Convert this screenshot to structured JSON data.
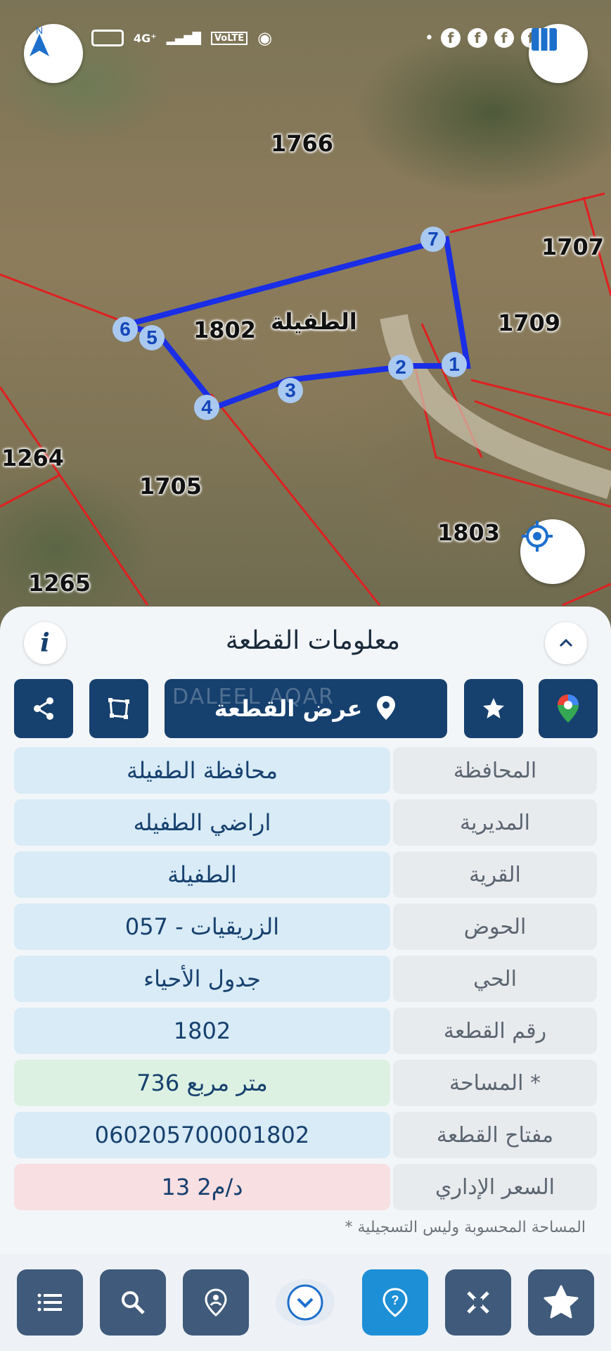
{
  "status_bar": {
    "network": "4G⁺",
    "volte": "VoLTE"
  },
  "map": {
    "parcels": [
      "1766",
      "1707",
      "1709",
      "1802",
      "1264",
      "1705",
      "1803",
      "1265"
    ],
    "area_label": "الطفيلة",
    "vertices": [
      "1",
      "2",
      "3",
      "4",
      "5",
      "6",
      "7"
    ],
    "colors": {
      "selected_outline": "#1a2ee6",
      "parcel_lines": "#e02020"
    }
  },
  "panel": {
    "title": "معلومات القطعة",
    "show_parcel_label": "عرض القطعة",
    "watermark": "DALEEL AQAR",
    "rows": [
      {
        "label": "المحافظة",
        "value": "محافظة الطفيلة",
        "bg": "#d8ebf6"
      },
      {
        "label": "المديرية",
        "value": "اراضي الطفيله",
        "bg": "#d8ebf6"
      },
      {
        "label": "القرية",
        "value": "الطفيلة",
        "bg": "#d8ebf6"
      },
      {
        "label": "الحوض",
        "value": "الزريقيات - 057",
        "bg": "#d8ebf6"
      },
      {
        "label": "الحي",
        "value": "جدول الأحياء",
        "bg": "#d8ebf6"
      },
      {
        "label": "رقم القطعة",
        "value": "1802",
        "bg": "#d8ebf6"
      },
      {
        "label": "المساحة *",
        "value": "736  متر مربع",
        "bg": "#dcf1e2"
      },
      {
        "label": "مفتاح القطعة",
        "value": "060205700001802",
        "bg": "#d8ebf6"
      },
      {
        "label": "السعر الإداري",
        "value": "13 د/م2",
        "bg": "#f8dfe2"
      }
    ],
    "note": "* المساحة المحسوبة وليس التسجيلية"
  },
  "icons": [
    "north-arrow-icon",
    "map-layers-icon",
    "my-location-icon",
    "info-icon",
    "chevron-up-icon",
    "share-icon",
    "polygon-icon",
    "pin-icon",
    "star-icon",
    "google-maps-icon",
    "list-icon",
    "search-icon",
    "location-person-icon",
    "chevron-down-icon",
    "help-icon",
    "tools-icon",
    "favorite-star-icon"
  ]
}
